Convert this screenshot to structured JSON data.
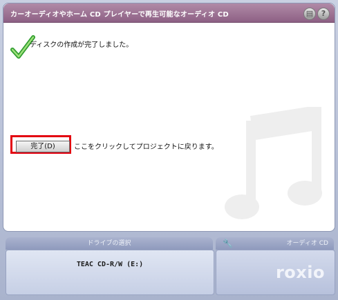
{
  "window": {
    "title": "カーオーディオやホーム CD プレイヤーで再生可能なオーディオ CD",
    "icons": [
      "print-icon",
      "help-icon"
    ]
  },
  "status": {
    "message": "ディスクの作成が完了しました。",
    "icon": "check-icon",
    "accent": "#e3000f"
  },
  "action": {
    "button_label": "完了(D)",
    "hint": "ここをクリックしてプロジェクトに戻ります。"
  },
  "bottom": {
    "drive_tab": "ドライブの選択",
    "drive_value": "TEAC CD-R/W (E:)",
    "project_tab": "オーディオ CD",
    "logo": "roxio"
  }
}
